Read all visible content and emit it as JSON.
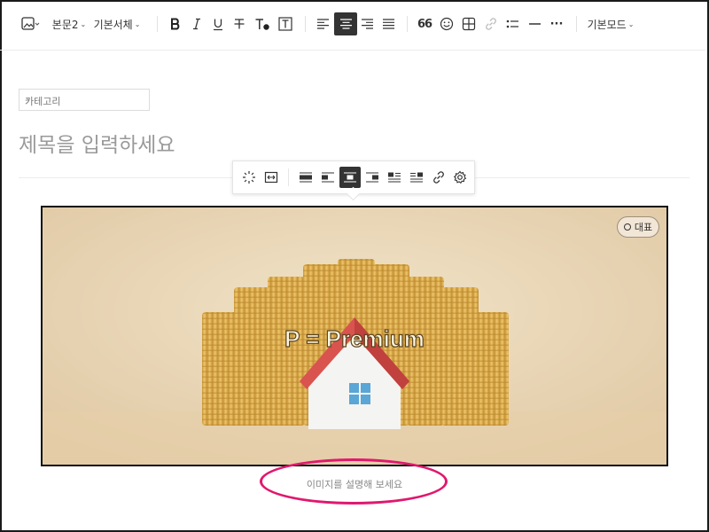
{
  "toolbar": {
    "paragraph_style": "본문2",
    "font_family": "기본서체",
    "mode": "기본모드",
    "quote_glyph": "66",
    "more_glyph": "···"
  },
  "editor": {
    "category_label": "카테고리",
    "title_placeholder": "제목을 입력하세요"
  },
  "image": {
    "overlay_text": "P = Premium",
    "representative_badge": "대표",
    "caption_placeholder": "이미지를 설명해 보세요"
  },
  "colors": {
    "highlight": "#e0186e",
    "active": "#333333",
    "image_bg": "#ead8b8"
  }
}
